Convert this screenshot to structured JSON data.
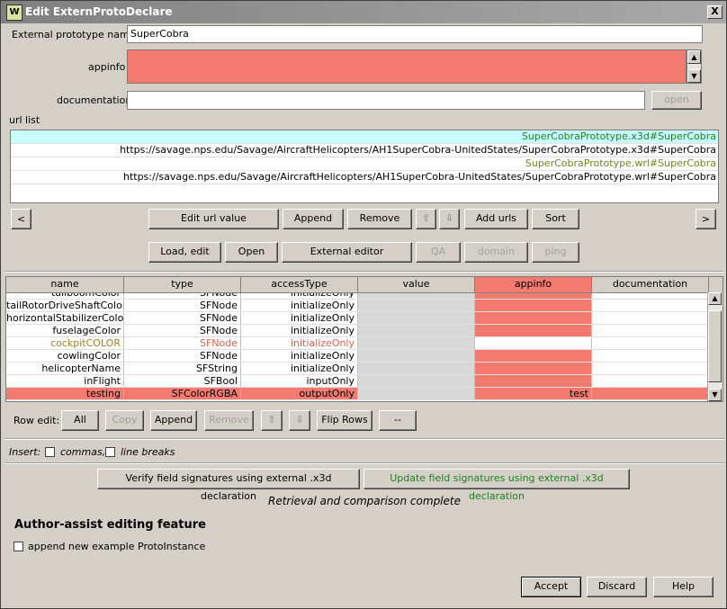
{
  "window": {
    "title": "Edit ExternProtoDeclare",
    "close_glyph": "X",
    "icon_glyph": "W"
  },
  "form": {
    "name_label": "External prototype name",
    "name_value": "SuperCobra",
    "appinfo_label": "appinfo",
    "documentation_label": "documentation",
    "open_label": "open"
  },
  "url_list": {
    "label": "url list",
    "items": [
      "SuperCobraPrototype.x3d#SuperCobra",
      "https://savage.nps.edu/Savage/AircraftHelicopters/AH1SuperCobra-UnitedStates/SuperCobraPrototype.x3d#SuperCobra",
      "SuperCobraPrototype.wrl#SuperCobra",
      "https://savage.nps.edu/Savage/AircraftHelicopters/AH1SuperCobra-UnitedStates/SuperCobraPrototype.wrl#SuperCobra"
    ]
  },
  "url_buttons": {
    "prev": "<",
    "next": ">",
    "edit": "Edit url value",
    "append": "Append",
    "remove": "Remove",
    "up_glyph": "⇧",
    "down_glyph": "⇩",
    "add_urls": "Add urls",
    "sort": "Sort",
    "load_edit": "Load, edit",
    "open": "Open",
    "external_editor": "External editor",
    "qa": "QA",
    "domain": "domain",
    "ping": "ping"
  },
  "table": {
    "columns": [
      "name",
      "type",
      "accessType",
      "value",
      "appinfo",
      "documentation"
    ],
    "rows": [
      {
        "name": "tailboomColor",
        "type": "SFNode",
        "access": "initializeOnly",
        "value": "",
        "appinfo": "",
        "doc": ""
      },
      {
        "name": "tailRotorDriveShaftColor",
        "type": "SFNode",
        "access": "initializeOnly",
        "value": "",
        "appinfo": "",
        "doc": ""
      },
      {
        "name": "horizontalStabilizerColor",
        "type": "SFNode",
        "access": "initializeOnly",
        "value": "",
        "appinfo": "",
        "doc": ""
      },
      {
        "name": "fuselageColor",
        "type": "SFNode",
        "access": "initializeOnly",
        "value": "",
        "appinfo": "",
        "doc": ""
      },
      {
        "name": "cockpitCOLOR",
        "type": "SFNode",
        "access": "initializeOnly",
        "value": "",
        "appinfo": "",
        "doc": ""
      },
      {
        "name": "cowlingColor",
        "type": "SFNode",
        "access": "initializeOnly",
        "value": "",
        "appinfo": "",
        "doc": ""
      },
      {
        "name": "helicopterName",
        "type": "SFString",
        "access": "initializeOnly",
        "value": "",
        "appinfo": "",
        "doc": ""
      },
      {
        "name": "inFlight",
        "type": "SFBool",
        "access": "inputOnly",
        "value": "",
        "appinfo": "",
        "doc": ""
      },
      {
        "name": "testing",
        "type": "SFColorRGBA",
        "access": "outputOnly",
        "value": "",
        "appinfo": "test",
        "doc": ""
      }
    ]
  },
  "row_edit": {
    "label": "Row edit:",
    "all": "All",
    "copy": "Copy",
    "append": "Append",
    "remove": "Remove",
    "up_glyph": "⇧",
    "down_glyph": "⇩",
    "flip_rows": "Flip Rows",
    "dashes": "--"
  },
  "insert": {
    "label": "Insert:",
    "commas": "commas,",
    "line_breaks": "line breaks"
  },
  "verify": {
    "verify_label": "Verify field signatures using external .x3d declaration",
    "update_label": "Update field signatures using external .x3d declaration",
    "status": "Retrieval and comparison complete"
  },
  "author_assist": {
    "heading": "Author-assist editing feature",
    "checkbox_label": "append new example ProtoInstance"
  },
  "footer": {
    "accept": "Accept",
    "discard": "Discard",
    "help": "Help"
  },
  "colors": {
    "salmon": "#f27a6f",
    "selected_url": "#c8ffff",
    "green_text": "#208020",
    "cockpit_text": "#a08020",
    "cockpit_type": "#e06050"
  }
}
